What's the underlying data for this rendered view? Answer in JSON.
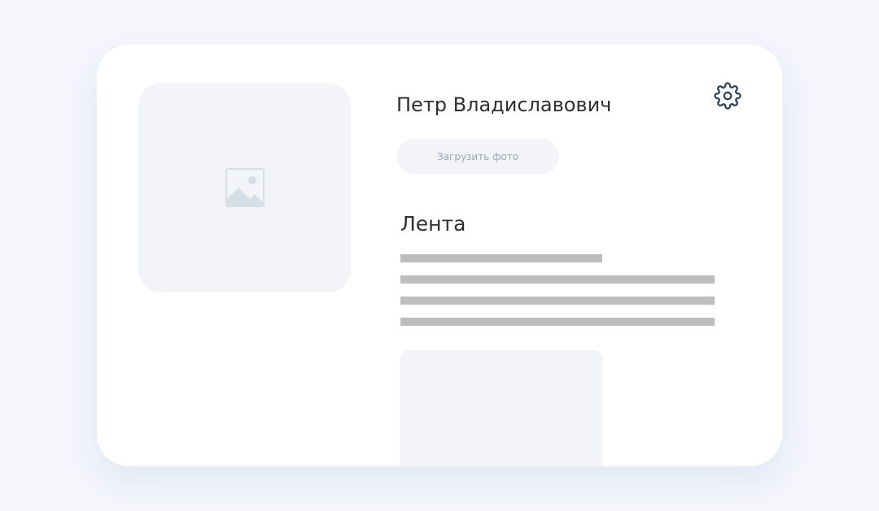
{
  "profile": {
    "name": "Петр Владиславович",
    "upload_label": "Загрузить фото"
  },
  "feed": {
    "title": "Лента"
  },
  "icons": {
    "avatar_placeholder": "image-placeholder-icon",
    "settings": "gear-icon"
  },
  "colors": {
    "background": "#f4f6fb",
    "card": "#ffffff",
    "placeholder": "#f2f4f8",
    "text_line": "#bdbdbd",
    "icon_dark": "#2f4356"
  }
}
